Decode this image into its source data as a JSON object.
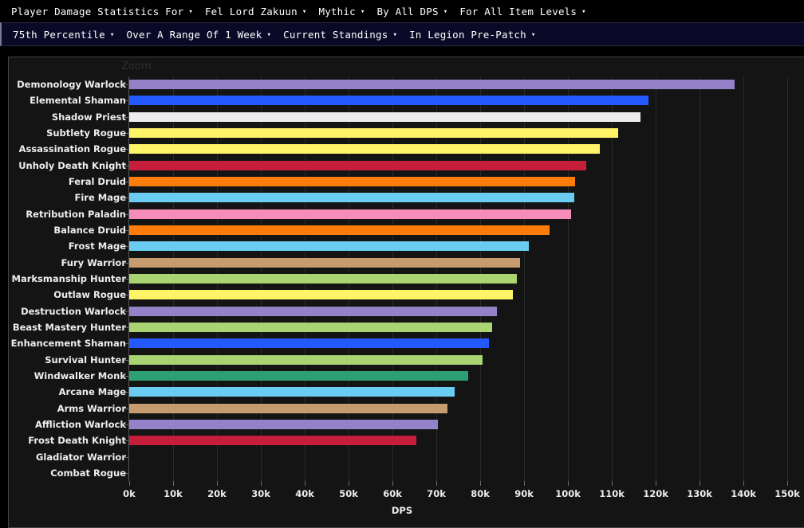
{
  "toolbars": {
    "primary": [
      {
        "label": "Player Damage Statistics For",
        "caret": "▾"
      },
      {
        "label": "Fel Lord Zakuun",
        "caret": "▾"
      },
      {
        "label": "Mythic",
        "caret": "▾"
      },
      {
        "label": "By All DPS",
        "caret": "▾"
      },
      {
        "label": "For All Item Levels",
        "caret": "▾"
      }
    ],
    "secondary": [
      {
        "label": "75th Percentile",
        "caret": "▾"
      },
      {
        "label": "Over A Range Of 1 Week",
        "caret": "▾"
      },
      {
        "label": "Current Standings",
        "caret": "▾"
      },
      {
        "label": "In Legion Pre-Patch",
        "caret": "▾"
      }
    ]
  },
  "chart_panel": {
    "zoom_label": "Zoom"
  },
  "chart_data": {
    "type": "bar",
    "orientation": "horizontal",
    "title": "",
    "xlabel": "DPS",
    "ylabel": "",
    "xlim": [
      0,
      153800
    ],
    "xticks": [
      0,
      10000,
      20000,
      30000,
      40000,
      50000,
      60000,
      70000,
      80000,
      90000,
      100000,
      110000,
      120000,
      130000,
      140000,
      150000
    ],
    "xtick_labels": [
      "0k",
      "10k",
      "20k",
      "30k",
      "40k",
      "50k",
      "60k",
      "70k",
      "80k",
      "90k",
      "100k",
      "110k",
      "120k",
      "130k",
      "140k",
      "150k"
    ],
    "grid": true,
    "legend": "none",
    "categories": [
      "Demonology Warlock",
      "Elemental Shaman",
      "Shadow Priest",
      "Subtlety Rogue",
      "Assassination Rogue",
      "Unholy Death Knight",
      "Feral Druid",
      "Fire Mage",
      "Retribution Paladin",
      "Balance Druid",
      "Frost Mage",
      "Fury Warrior",
      "Marksmanship Hunter",
      "Outlaw Rogue",
      "Destruction Warlock",
      "Beast Mastery Hunter",
      "Enhancement Shaman",
      "Survival Hunter",
      "Windwalker Monk",
      "Arcane Mage",
      "Arms Warrior",
      "Affliction Warlock",
      "Frost Death Knight",
      "Gladiator Warrior",
      "Combat Rogue"
    ],
    "values": [
      138000,
      118300,
      116500,
      111500,
      107200,
      104200,
      101600,
      101500,
      100800,
      95800,
      91000,
      89000,
      88300,
      87500,
      83800,
      82800,
      81900,
      80600,
      77200,
      74200,
      72600,
      70400,
      65400,
      0,
      0
    ],
    "colors": [
      "#9482C9",
      "#2459FF",
      "#EDEDED",
      "#FFF468",
      "#FFF468",
      "#C41E3A",
      "#FF7C0A",
      "#69CCF0",
      "#F58CBA",
      "#FF7C0A",
      "#69CCF0",
      "#C69B6D",
      "#AAD372",
      "#FFF468",
      "#9482C9",
      "#AAD372",
      "#2459FF",
      "#AAD372",
      "#2E9E75",
      "#69CCF0",
      "#C69B6D",
      "#9482C9",
      "#C41E3A",
      "#C69B6D",
      "#FFF468"
    ]
  }
}
